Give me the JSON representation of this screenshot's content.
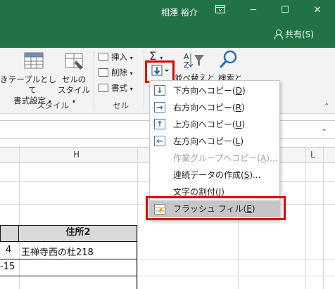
{
  "titlebar": {
    "user_name": "相澤 裕介",
    "ribbon_display_icon": "ribbon-display-icon",
    "minimize": "─",
    "restore": "☐",
    "close": "✕",
    "share_label": "共有(S)"
  },
  "ribbon": {
    "styles_group": {
      "truncated_label": "き",
      "format_as_table": [
        "テーブルとして",
        "書式設定"
      ],
      "cell_styles": [
        "セルの",
        "スタイル"
      ],
      "group_label": "スタイル"
    },
    "cells_group": {
      "insert": "挿入",
      "delete": "削除",
      "format": "書式",
      "group_label": "セル"
    },
    "editing_group": {
      "autosum_icon": "sigma-icon",
      "fill_button_icon": "fill-down-arrow-icon",
      "sort_filter_partial": "並べ替えと",
      "find_select_partial": "検索と"
    }
  },
  "fill_menu": {
    "items": [
      {
        "label": "下方向へコピー(",
        "key": "D",
        "suffix": ")",
        "icon": "↓",
        "enabled": true
      },
      {
        "label": "右方向へコピー(",
        "key": "R",
        "suffix": ")",
        "icon": "→",
        "enabled": true
      },
      {
        "label": "上方向へコピー(",
        "key": "U",
        "suffix": ")",
        "icon": "↑",
        "enabled": true
      },
      {
        "label": "左方向へコピー(",
        "key": "L",
        "suffix": ")",
        "icon": "←",
        "enabled": true
      },
      {
        "label": "作業グループへコピー(",
        "key": "A",
        "suffix": ")...",
        "enabled": false
      },
      {
        "label": "連続データの作成(",
        "key": "S",
        "suffix": ")...",
        "enabled": true
      },
      {
        "label": "文字の割付(",
        "key": "J",
        "suffix": ")",
        "enabled": true
      },
      {
        "label": "フラッシュ フィル(",
        "key": "E",
        "suffix": ")",
        "icon": "flash-fill-icon",
        "enabled": true,
        "highlighted": true
      }
    ]
  },
  "sheet": {
    "columns": {
      "h": "H",
      "l": "L"
    },
    "header_cell": "住所2",
    "rows": [
      {
        "left": "4",
        "h": "王禅寺西の杜218"
      },
      {
        "left": "-15",
        "h": ""
      },
      {
        "left": "",
        "h": ""
      }
    ]
  },
  "colors": {
    "titlebar": "#217346",
    "highlight_box": "#e00000",
    "menu_highlight": "#c6c6c6"
  }
}
